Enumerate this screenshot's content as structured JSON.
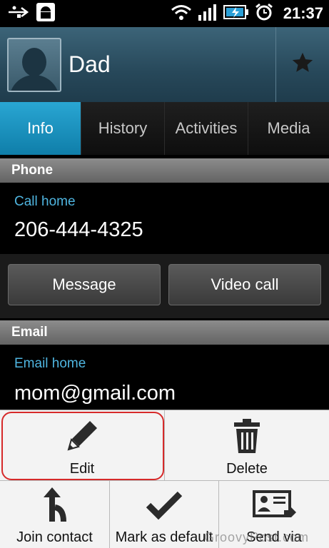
{
  "status_bar": {
    "time": "21:37",
    "left_icons": [
      "usb-icon",
      "android-debug-icon"
    ],
    "right_icons": [
      "wifi-icon",
      "signal-icon",
      "battery-charging-icon",
      "alarm-icon"
    ]
  },
  "contact": {
    "name": "Dad",
    "favorite_icon": "star-icon"
  },
  "tabs": [
    {
      "label": "Info",
      "active": true
    },
    {
      "label": "History",
      "active": false
    },
    {
      "label": "Activities",
      "active": false
    },
    {
      "label": "Media",
      "active": false
    }
  ],
  "phone_section": {
    "header": "Phone",
    "label": "Call home",
    "value": "206-444-4325",
    "buttons": {
      "message": "Message",
      "video_call": "Video call"
    }
  },
  "email_section": {
    "header": "Email",
    "label": "Email home",
    "value": "mom@gmail.com"
  },
  "menu": {
    "items": [
      {
        "label": "Edit",
        "icon": "pencil-icon"
      },
      {
        "label": "Delete",
        "icon": "trash-icon"
      },
      {
        "label": "Join contact",
        "icon": "join-icon"
      },
      {
        "label": "Mark as default",
        "icon": "checkmark-icon"
      },
      {
        "label": "Send via",
        "icon": "contact-card-icon"
      }
    ]
  },
  "watermark": "GroovyPost.com",
  "colors": {
    "accent": "#1b98c8",
    "label_blue": "#4fb5e0",
    "highlight_red": "#d62a2a"
  }
}
